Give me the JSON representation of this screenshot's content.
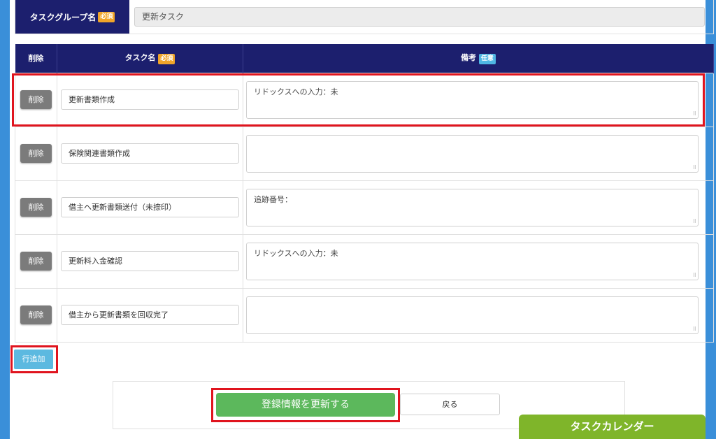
{
  "group": {
    "label": "タスクグループ名",
    "required_badge": "必須",
    "value": "更新タスク"
  },
  "table": {
    "headers": {
      "delete": "削除",
      "task_name": "タスク名",
      "task_name_badge": "必須",
      "note": "備考",
      "note_badge": "任意"
    },
    "rows": [
      {
        "delete_label": "削除",
        "task": "更新書類作成",
        "note": "リドックスへの入力：未"
      },
      {
        "delete_label": "削除",
        "task": "保険関連書類作成",
        "note": ""
      },
      {
        "delete_label": "削除",
        "task": "借主へ更新書類送付（未捺印）",
        "note": "追跡番号："
      },
      {
        "delete_label": "削除",
        "task": "更新料入金確認",
        "note": "リドックスへの入力：未"
      },
      {
        "delete_label": "削除",
        "task": "借主から更新書類を回収完了",
        "note": ""
      }
    ]
  },
  "add_row_label": "行追加",
  "actions": {
    "submit_label": "登録情報を更新する",
    "back_label": "戻る"
  },
  "calendar_label": "タスクカレンダー",
  "colors": {
    "header_navy": "#1c1f6e",
    "required_badge": "#f0a52a",
    "optional_badge": "#4fb6e3",
    "submit_green": "#5cb85c",
    "calendar_green": "#7fb52a",
    "highlight_red": "#e0141e",
    "page_blue": "#3a8fd9"
  }
}
